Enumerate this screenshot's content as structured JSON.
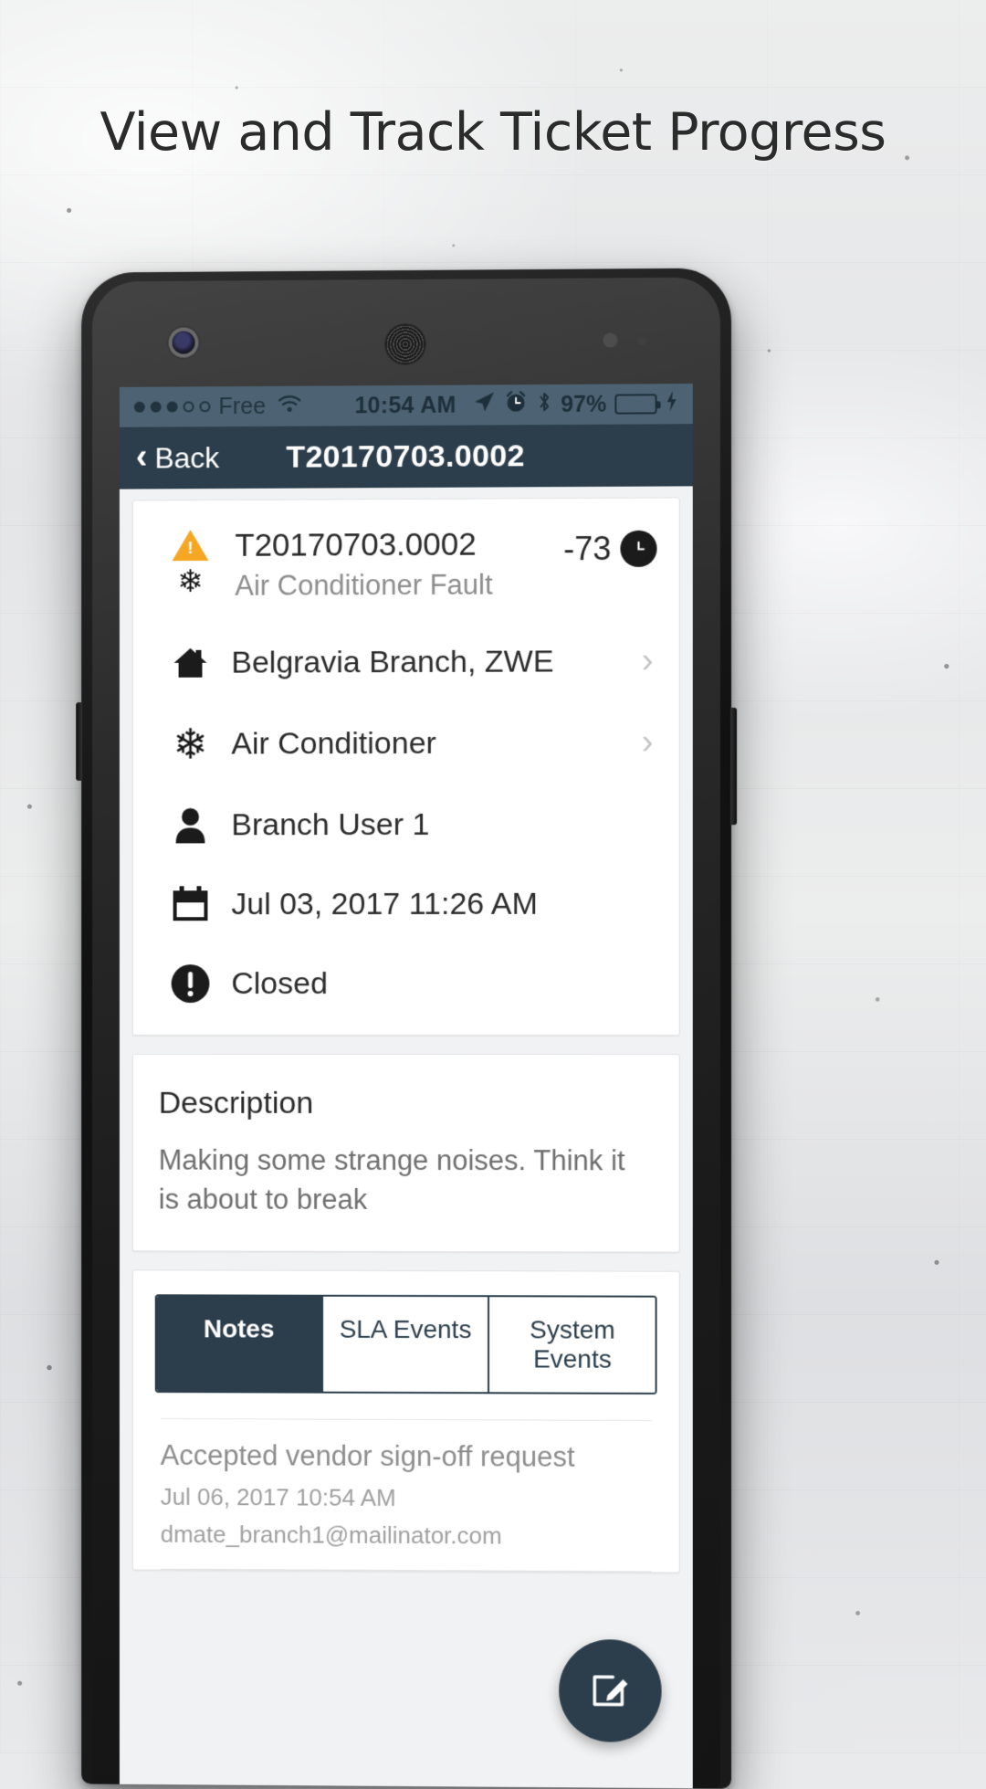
{
  "headline": "View and Track Ticket Progress",
  "status_bar": {
    "signal_dots_filled": 3,
    "signal_dots_total": 5,
    "carrier": "Free",
    "wifi_icon": "wifi-icon",
    "time": "10:54 AM",
    "location_icon": "location-arrow-icon",
    "alarm_icon": "alarm-clock-icon",
    "bluetooth_icon": "bluetooth-icon",
    "battery_percent": "97%",
    "battery_level": 97,
    "charging_icon": "lightning-bolt-icon",
    "battery_color": "#4cd964",
    "bar_color": "#4d6373"
  },
  "nav_bar": {
    "back_label": "Back",
    "back_icon": "chevron-left-icon",
    "title": "T20170703.0002",
    "bar_color": "#2c3e4b"
  },
  "ticket": {
    "priority_icon": "warning-triangle-icon",
    "priority_color": "#f5a623",
    "asset_icon": "snowflake-icon",
    "id": "T20170703.0002",
    "fault": "Air Conditioner Fault",
    "sla_value": "-73",
    "sla_icon": "clock-icon",
    "details": [
      {
        "icon": "home-icon",
        "label": "Belgravia Branch, ZWE",
        "chevron": true,
        "chevron_icon": "chevron-right-icon"
      },
      {
        "icon": "snowflake-icon",
        "label": "Air Conditioner",
        "chevron": true,
        "chevron_icon": "chevron-right-icon"
      },
      {
        "icon": "person-icon",
        "label": "Branch User 1",
        "chevron": false,
        "chevron_icon": ""
      },
      {
        "icon": "calendar-icon",
        "label": "Jul 03, 2017 11:26 AM",
        "chevron": false,
        "chevron_icon": ""
      },
      {
        "icon": "exclamation-circle-icon",
        "label": "Closed",
        "chevron": false,
        "chevron_icon": ""
      }
    ]
  },
  "description": {
    "title": "Description",
    "body": "Making some strange noises. Think it is about to break"
  },
  "tabs": [
    {
      "label": "Notes",
      "active": true
    },
    {
      "label": "SLA Events",
      "active": false
    },
    {
      "label": "System Events",
      "active": false
    }
  ],
  "notes": [
    {
      "title": "Accepted vendor sign-off request",
      "date": "Jul 06, 2017 10:54 AM",
      "email": "dmate_branch1@mailinator.com"
    }
  ],
  "fab": {
    "icon": "edit-pencil-icon",
    "color": "#2c3e4b"
  }
}
